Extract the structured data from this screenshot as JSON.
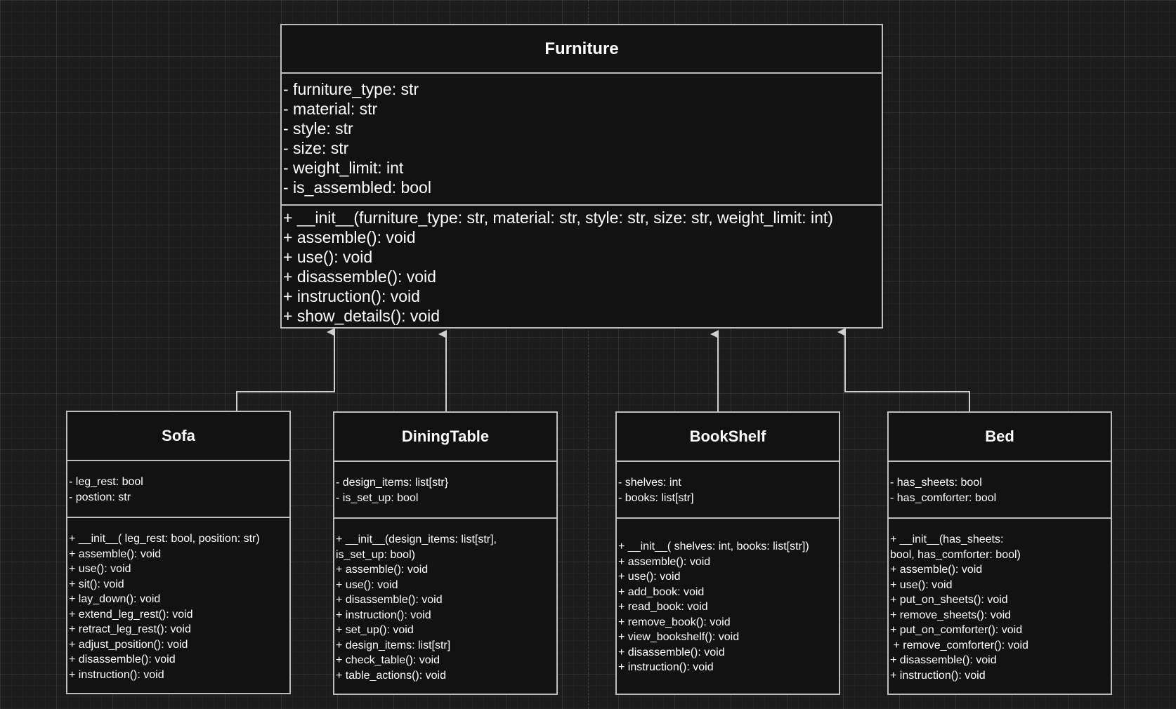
{
  "diagram": {
    "furniture": {
      "name": "Furniture",
      "attributes": [
        "- furniture_type: str",
        "- material: str",
        "- style: str",
        "- size: str",
        "- weight_limit: int",
        "- is_assembled: bool"
      ],
      "methods": [
        "+ __init__(furniture_type: str, material: str, style: str, size: str, weight_limit: int)",
        "+ assemble(): void",
        "+ use(): void",
        "+ disassemble(): void",
        "+ instruction(): void",
        "+ show_details(): void"
      ]
    },
    "sofa": {
      "name": "Sofa",
      "attributes": [
        "- leg_rest: bool",
        "- postion: str"
      ],
      "methods": [
        "+ __init__( leg_rest: bool, position: str)",
        "+ assemble(): void",
        "+ use(): void",
        "+ sit(): void",
        "+ lay_down(): void",
        "+ extend_leg_rest(): void",
        "+ retract_leg_rest(): void",
        "+ adjust_position(): void",
        "+ disassemble(): void",
        "+ instruction(): void"
      ]
    },
    "diningtable": {
      "name": "DiningTable",
      "attributes": [
        "- design_items: list[str}",
        "- is_set_up: bool"
      ],
      "methods": [
        "+ __init__(design_items: list[str],",
        "is_set_up: bool)",
        "+ assemble(): void",
        "+ use(): void",
        "+ disassemble(): void",
        "+ instruction(): void",
        "+ set_up(): void",
        "+ design_items: list[str]",
        "+ check_table(): void",
        "+ table_actions(): void"
      ]
    },
    "bookshelf": {
      "name": "BookShelf",
      "attributes": [
        "- shelves: int",
        "- books: list[str]"
      ],
      "methods": [
        "+ __init__( shelves: int, books: list[str])",
        "+ assemble(): void",
        "+ use(): void",
        "+ add_book: void",
        "+ read_book: void",
        "+ remove_book(): void",
        "+ view_bookshelf(): void",
        "+ disassemble(): void",
        "+ instruction(): void"
      ]
    },
    "bed": {
      "name": "Bed",
      "attributes": [
        "- has_sheets: bool",
        "- has_comforter: bool"
      ],
      "methods": [
        "+ __init__(has_sheets:",
        "bool, has_comforter: bool)",
        "+ assemble(): void",
        "+ use(): void",
        "+ put_on_sheets(): void",
        "+ remove_sheets(): void",
        "+ put_on_comforter(): void",
        " + remove_comforter(): void",
        "+ disassemble(): void",
        "+ instruction(): void"
      ]
    },
    "relations": [
      {
        "from": "Sofa",
        "to": "Furniture",
        "type": "inheritance"
      },
      {
        "from": "DiningTable",
        "to": "Furniture",
        "type": "inheritance"
      },
      {
        "from": "BookShelf",
        "to": "Furniture",
        "type": "inheritance"
      },
      {
        "from": "Bed",
        "to": "Furniture",
        "type": "inheritance"
      }
    ],
    "colors": {
      "background": "#1c1c1c",
      "box_fill": "#121212",
      "stroke": "#bdbdbd",
      "text": "#ffffff"
    }
  }
}
